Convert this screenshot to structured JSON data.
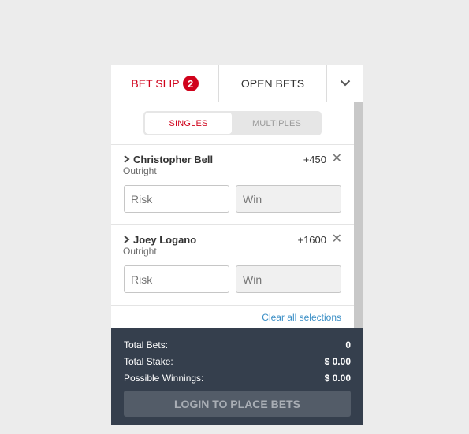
{
  "tabs": {
    "bet_slip_label": "BET SLIP",
    "bet_slip_count": "2",
    "open_bets_label": "OPEN BETS"
  },
  "toggle": {
    "singles_label": "SINGLES",
    "multiples_label": "MULTIPLES",
    "selected": "SINGLES"
  },
  "selections": [
    {
      "name": "Christopher Bell",
      "market": "Outright",
      "odds": "+450",
      "risk_placeholder": "Risk",
      "win_placeholder": "Win"
    },
    {
      "name": "Joey Logano",
      "market": "Outright",
      "odds": "+1600",
      "risk_placeholder": "Risk",
      "win_placeholder": "Win"
    }
  ],
  "clear_all_label": "Clear all selections",
  "summary": {
    "total_bets_label": "Total Bets:",
    "total_bets_value": "0",
    "total_stake_label": "Total Stake:",
    "total_stake_value": "$ 0.00",
    "possible_winnings_label": "Possible Winnings:",
    "possible_winnings_value": "$ 0.00"
  },
  "login_button_label": "LOGIN TO PLACE BETS",
  "colors": {
    "accent_red": "#d0021b",
    "link_blue": "#3b8fc6",
    "footer_bg": "#353f4d",
    "button_bg": "#535c68",
    "page_bg": "#ececec"
  },
  "icons": {
    "close": "close-icon",
    "chevron_down": "chevron-down-icon",
    "chevron_right": "chevron-right-icon"
  }
}
